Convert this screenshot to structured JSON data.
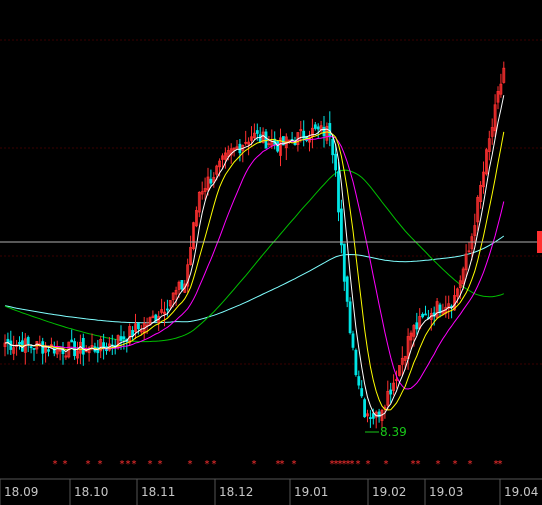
{
  "colors": {
    "background": "#000000",
    "grid": "#3a0000",
    "up": "#ff3030",
    "down": "#00e5e5",
    "ma_fast": "#ffffff",
    "ma_yellow": "#ffff00",
    "ma_magenta": "#ff00ff",
    "ma_green": "#00c000",
    "ma_cyan": "#80ffff",
    "price_line": "#b0b0b0",
    "low_label": "#19c819",
    "star": "#ff3030",
    "axis_text": "#c8c8c8"
  },
  "chart_data": {
    "type": "candlestick",
    "x_axis": {
      "tick_labels": [
        "18.09",
        "18.10",
        "18.11",
        "18.12",
        "19.01",
        "19.02",
        "19.03",
        "19.04"
      ]
    },
    "annotations": {
      "low_marker": "8.39"
    },
    "signal_marker": "*",
    "signal_counts_per_month": [
      2,
      2,
      5,
      3,
      2,
      9,
      3,
      2
    ],
    "current_price_marker": true,
    "moving_averages": [
      "ma_fast",
      "ma_yellow",
      "ma_magenta",
      "ma_green",
      "ma_cyan"
    ],
    "y_lim": [
      8.0,
      19.5
    ]
  }
}
